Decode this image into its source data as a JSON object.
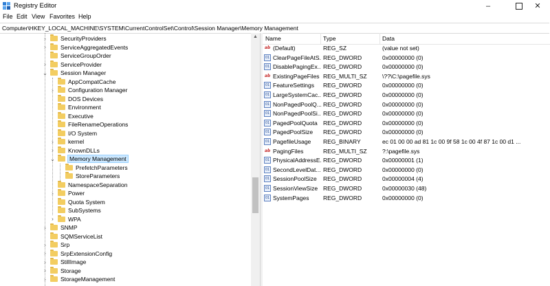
{
  "window": {
    "title": "Registry Editor",
    "minimize_icon": "minimize-icon",
    "maximize_icon": "maximize-icon",
    "close_icon": "close-icon"
  },
  "menu": [
    "File",
    "Edit",
    "View",
    "Favorites",
    "Help"
  ],
  "address": "Computer\\HKEY_LOCAL_MACHINE\\SYSTEM\\CurrentControlSet\\Control\\Session Manager\\Memory Management",
  "tree": {
    "items": [
      {
        "label": "SecurityProviders",
        "level": 0,
        "state": "collapsed"
      },
      {
        "label": "ServiceAggregatedEvents",
        "level": 0,
        "state": "collapsed"
      },
      {
        "label": "ServiceGroupOrder",
        "level": 0,
        "state": "leaf"
      },
      {
        "label": "ServiceProvider",
        "level": 0,
        "state": "collapsed"
      },
      {
        "label": "Session Manager",
        "level": 0,
        "state": "expanded"
      },
      {
        "label": "AppCompatCache",
        "level": 1,
        "state": "leaf"
      },
      {
        "label": "Configuration Manager",
        "level": 1,
        "state": "collapsed"
      },
      {
        "label": "DOS Devices",
        "level": 1,
        "state": "leaf"
      },
      {
        "label": "Environment",
        "level": 1,
        "state": "leaf"
      },
      {
        "label": "Executive",
        "level": 1,
        "state": "leaf"
      },
      {
        "label": "FileRenameOperations",
        "level": 1,
        "state": "leaf"
      },
      {
        "label": "I/O System",
        "level": 1,
        "state": "leaf"
      },
      {
        "label": "kernel",
        "level": 1,
        "state": "collapsed"
      },
      {
        "label": "KnownDLLs",
        "level": 1,
        "state": "collapsed"
      },
      {
        "label": "Memory Management",
        "level": 1,
        "state": "expanded",
        "selected": true
      },
      {
        "label": "PrefetchParameters",
        "level": 2,
        "state": "leaf"
      },
      {
        "label": "StoreParameters",
        "level": 2,
        "state": "leaf"
      },
      {
        "label": "NamespaceSeparation",
        "level": 1,
        "state": "leaf"
      },
      {
        "label": "Power",
        "level": 1,
        "state": "collapsed"
      },
      {
        "label": "Quota System",
        "level": 1,
        "state": "leaf"
      },
      {
        "label": "SubSystems",
        "level": 1,
        "state": "leaf"
      },
      {
        "label": "WPA",
        "level": 1,
        "state": "collapsed"
      },
      {
        "label": "SNMP",
        "level": 0,
        "state": "collapsed"
      },
      {
        "label": "SQMServiceList",
        "level": 0,
        "state": "leaf"
      },
      {
        "label": "Srp",
        "level": 0,
        "state": "collapsed"
      },
      {
        "label": "SrpExtensionConfig",
        "level": 0,
        "state": "collapsed"
      },
      {
        "label": "StillImage",
        "level": 0,
        "state": "collapsed"
      },
      {
        "label": "Storage",
        "level": 0,
        "state": "collapsed"
      },
      {
        "label": "StorageManagement",
        "level": 0,
        "state": "collapsed"
      }
    ]
  },
  "list": {
    "columns": [
      "Name",
      "Type",
      "Data"
    ],
    "rows": [
      {
        "icon": "sz",
        "name": "(Default)",
        "type": "REG_SZ",
        "data": "(value not set)"
      },
      {
        "icon": "bin",
        "name": "ClearPageFileAtS...",
        "type": "REG_DWORD",
        "data": "0x00000000 (0)"
      },
      {
        "icon": "bin",
        "name": "DisablePagingEx...",
        "type": "REG_DWORD",
        "data": "0x00000000 (0)"
      },
      {
        "icon": "sz",
        "name": "ExistingPageFiles",
        "type": "REG_MULTI_SZ",
        "data": "\\??\\C:\\pagefile.sys"
      },
      {
        "icon": "bin",
        "name": "FeatureSettings",
        "type": "REG_DWORD",
        "data": "0x00000000 (0)"
      },
      {
        "icon": "bin",
        "name": "LargeSystemCac...",
        "type": "REG_DWORD",
        "data": "0x00000000 (0)"
      },
      {
        "icon": "bin",
        "name": "NonPagedPoolQ...",
        "type": "REG_DWORD",
        "data": "0x00000000 (0)"
      },
      {
        "icon": "bin",
        "name": "NonPagedPoolSi...",
        "type": "REG_DWORD",
        "data": "0x00000000 (0)"
      },
      {
        "icon": "bin",
        "name": "PagedPoolQuota",
        "type": "REG_DWORD",
        "data": "0x00000000 (0)"
      },
      {
        "icon": "bin",
        "name": "PagedPoolSize",
        "type": "REG_DWORD",
        "data": "0x00000000 (0)"
      },
      {
        "icon": "bin",
        "name": "PagefileUsage",
        "type": "REG_BINARY",
        "data": "ec 01 00 00 ad 81 1c 00 9f 58 1c 00 4f 87 1c 00 d1 ..."
      },
      {
        "icon": "sz",
        "name": "PagingFiles",
        "type": "REG_MULTI_SZ",
        "data": "?:\\pagefile.sys"
      },
      {
        "icon": "bin",
        "name": "PhysicalAddressE...",
        "type": "REG_DWORD",
        "data": "0x00000001 (1)"
      },
      {
        "icon": "bin",
        "name": "SecondLevelDat...",
        "type": "REG_DWORD",
        "data": "0x00000000 (0)"
      },
      {
        "icon": "bin",
        "name": "SessionPoolSize",
        "type": "REG_DWORD",
        "data": "0x00000004 (4)"
      },
      {
        "icon": "bin",
        "name": "SessionViewSize",
        "type": "REG_DWORD",
        "data": "0x00000030 (48)"
      },
      {
        "icon": "bin",
        "name": "SystemPages",
        "type": "REG_DWORD",
        "data": "0x00000000 (0)"
      }
    ]
  }
}
